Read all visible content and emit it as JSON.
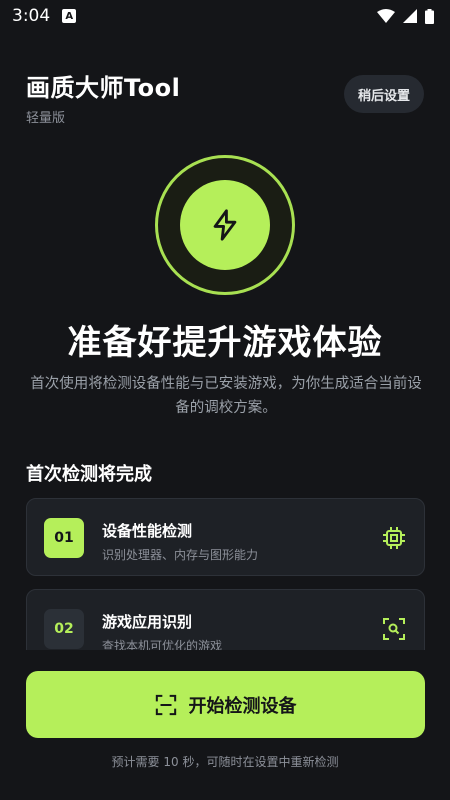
{
  "status_bar": {
    "time": "3:04",
    "notification_icon": "a-letter-icon"
  },
  "header": {
    "title": "画质大师Tool",
    "subtitle": "轻量版",
    "later_button": "稍后设置"
  },
  "hero": {
    "icon": "lightning-icon",
    "headline": "准备好提升游戏体验",
    "description": "首次使用将检测设备性能与已安装游戏，为你生成适合当前设备的调校方案。"
  },
  "section": {
    "title": "首次检测将完成",
    "items": [
      {
        "number": "01",
        "title": "设备性能检测",
        "subtitle": "识别处理器、内存与图形能力",
        "icon": "chip-icon"
      },
      {
        "number": "02",
        "title": "游戏应用识别",
        "subtitle": "查找本机可优化的游戏",
        "icon": "scan-search-icon"
      }
    ]
  },
  "cta": {
    "label": "开始检测设备",
    "icon": "scan-icon"
  },
  "footnote": "预计需要 10 秒，可随时在设置中重新检测",
  "colors": {
    "accent": "#b5ef5a",
    "background": "#141518",
    "card": "#1e2126"
  }
}
